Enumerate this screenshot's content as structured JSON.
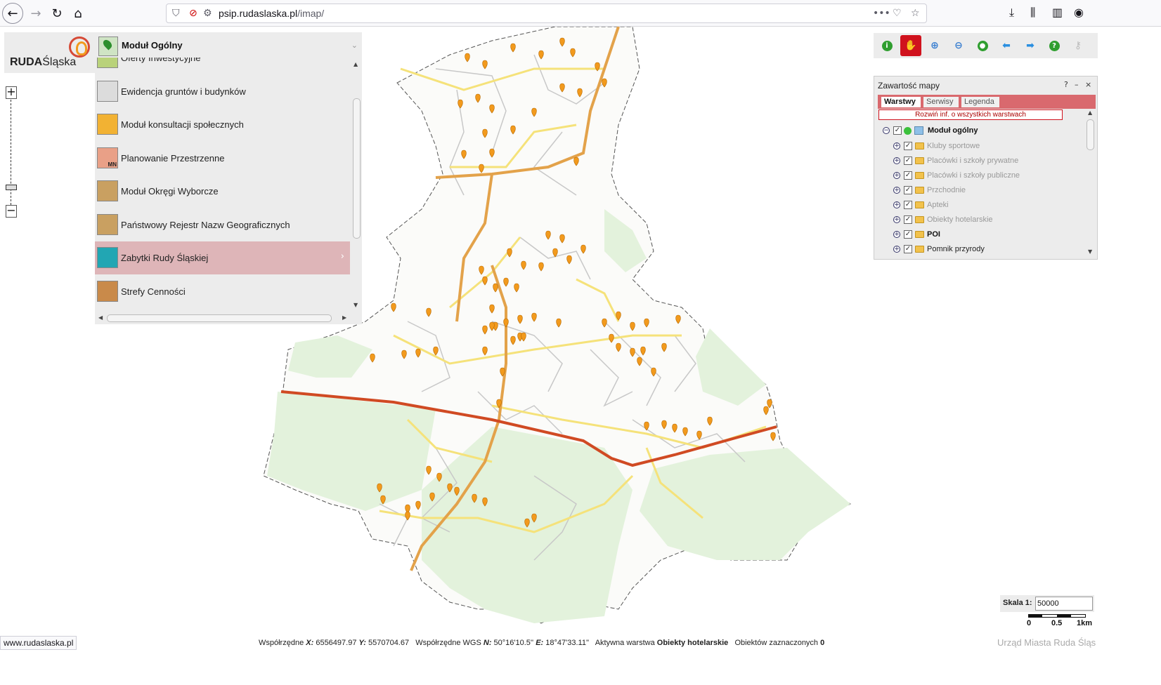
{
  "browser": {
    "url_host": "psip.rudaslaska.pl",
    "url_path": "/imap/"
  },
  "logo": {
    "bold": "RUDA",
    "rest": "Śląska"
  },
  "module_panel": {
    "title": "Moduł Ogólny",
    "items": [
      {
        "label": "Oferty Inwestycyjne",
        "icon": "map-grid-icon",
        "color": "#b9d27a"
      },
      {
        "label": "Ewidencja gruntów i budynków",
        "icon": "parcel-map-icon",
        "color": "#dcdcdc"
      },
      {
        "label": "Moduł konsultacji społecznych",
        "icon": "people-icon",
        "color": "#f2b233"
      },
      {
        "label": "Planowanie Przestrzenne",
        "icon": "zoning-icon",
        "color": "#e9a087",
        "badge": "MN"
      },
      {
        "label": "Moduł Okręgi Wyborcze",
        "icon": "district-icon",
        "color": "#c9a061"
      },
      {
        "label": "Państwowy Rejestr Nazw Geograficznych",
        "icon": "geo-names-icon",
        "color": "#c9a061"
      },
      {
        "label": "Zabytki Rudy Śląskiej",
        "icon": "monument-icon",
        "color": "#22a6b3",
        "active": true
      },
      {
        "label": "Strefy Cenności",
        "icon": "value-zones-icon",
        "color": "#c98a4a"
      }
    ]
  },
  "toolbar": [
    {
      "name": "info-tool",
      "icon": "info-icon",
      "color": "#2f9e2f"
    },
    {
      "name": "pan-tool",
      "icon": "hand-icon",
      "color": "#f5b000",
      "active": true
    },
    {
      "name": "zoom-in-tool",
      "icon": "zoom-in-icon",
      "color": "#3a7fd0"
    },
    {
      "name": "zoom-out-tool",
      "icon": "zoom-out-icon",
      "color": "#3a7fd0"
    },
    {
      "name": "full-extent-tool",
      "icon": "globe-icon",
      "color": "#2f9e2f"
    },
    {
      "name": "previous-view-tool",
      "icon": "arrow-left-icon",
      "color": "#2a8fe0"
    },
    {
      "name": "next-view-tool",
      "icon": "arrow-right-icon",
      "color": "#2a8fe0"
    },
    {
      "name": "help-tool",
      "icon": "help-icon",
      "color": "#2f9e2f"
    },
    {
      "name": "measure-tool",
      "icon": "key-icon",
      "color": "#bbbbbb"
    }
  ],
  "contents": {
    "title": "Zawartość mapy",
    "help": "?",
    "minimize": "–",
    "close": "×",
    "tabs": [
      {
        "label": "Warstwy",
        "active": true
      },
      {
        "label": "Serwisy",
        "active": false
      },
      {
        "label": "Legenda",
        "active": false
      }
    ],
    "expand_all": "Rozwiń inf. o wszystkich warstwach",
    "root": "Moduł ogólny",
    "layers": [
      {
        "label": "Kluby sportowe",
        "style": "grey"
      },
      {
        "label": "Placówki i szkoły prywatne",
        "style": "grey"
      },
      {
        "label": "Placówki i szkoły publiczne",
        "style": "grey"
      },
      {
        "label": "Przchodnie",
        "style": "grey"
      },
      {
        "label": "Apteki",
        "style": "grey"
      },
      {
        "label": "Obiekty hotelarskie",
        "style": "grey"
      },
      {
        "label": "POI",
        "style": "bold"
      },
      {
        "label": "Pomnik przyrody",
        "style": "dark"
      }
    ]
  },
  "scale": {
    "label": "Skala 1:",
    "value": "50000",
    "ticks": [
      "0",
      "0.5",
      "1km"
    ]
  },
  "status": {
    "browser_status": "www.rudaslaska.pl",
    "coords_label": "Współrzędne",
    "x_label": "X:",
    "x_value": "6556497.97",
    "y_label": "Y:",
    "y_value": "5570704.67",
    "wgs_label": "Współrzędne WGS",
    "n_label": "N:",
    "n_value": "50°16'10.5''",
    "e_label": "E:",
    "e_value": "18°47'33.11''",
    "active_layer_label": "Aktywna warstwa",
    "active_layer_value": "Obiekty hotelarskie",
    "selected_label": "Obiektów zaznaczonych",
    "selected_value": "0"
  },
  "credits": "Urząd Miasta Ruda Śląs",
  "colors": {
    "accent": "#d0121d",
    "tab_bar": "#d9696e",
    "active_item": "#deb5b8",
    "marker": "#f29a1d",
    "highway": "#d04a23",
    "main_road": "#e3a24a",
    "road": "#f5e27a",
    "street": "#c8c8c8",
    "green": "#e3f2dc"
  }
}
